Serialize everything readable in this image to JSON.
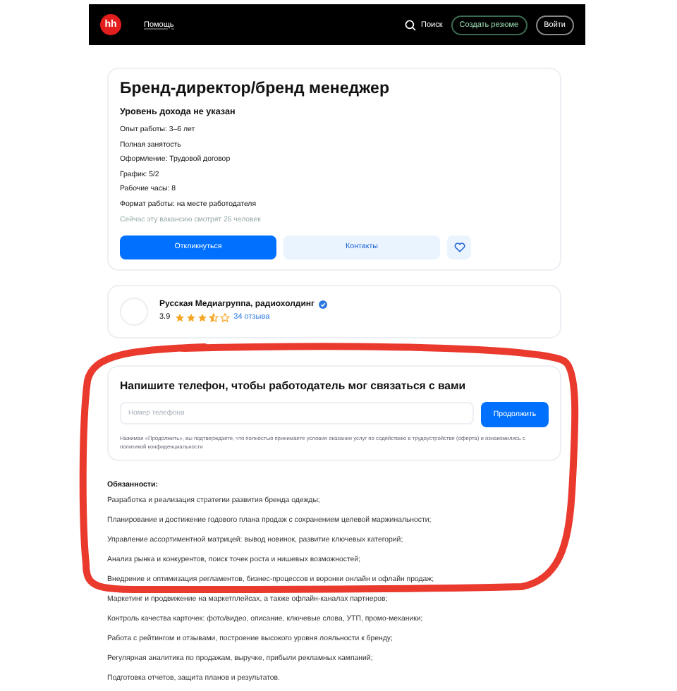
{
  "header": {
    "logo": "hh",
    "help_link": "Помощь",
    "search": "Поиск",
    "create_resume": "Создать резюме",
    "login": "Войти"
  },
  "vacancy": {
    "title": "Бренд-директор/бренд менеджер",
    "salary": "Уровень дохода не указан",
    "details": [
      "Опыт работы: 3–6 лет",
      "Полная занятость",
      "Оформление:  Трудовой договор",
      "График: 5/2",
      "Рабочие часы: 8",
      "Формат работы: на месте работодателя"
    ],
    "viewers": "Сейчас эту вакансию смотрят 26 человек",
    "apply_button": "Откликнуться",
    "contacts_button": "Контакты",
    "favorite": false
  },
  "employer": {
    "name": "Русская Медиагруппа, радиохолдинг",
    "verified": true,
    "rating": "3.9",
    "stars": 3.5,
    "reviews": "34 отзыва"
  },
  "phone_form": {
    "heading": "Напишите телефон, чтобы работодатель мог связаться с вами",
    "placeholder": "Номер телефона",
    "button": "Продолжить",
    "consent": "Нажимая «Продолжить», вы подтверждаете, что полностью принимаете условия оказания услуг по содействию в трудоустройстве (оферта) и ознакомились с политикой конфиденциальности"
  },
  "description": {
    "heading": "Обязанности:",
    "items": [
      "Разработка и реализация стратегии развития бренда одежды;",
      "Планирование и достижение годового плана продаж с сохранением целевой маржинальности;",
      "Управление ассортиментной матрицей: вывод новинок, развитие ключевых категорий;",
      "Анализ рынка и конкурентов, поиск точек роста и нишевых возможностей;",
      "Внедрение и оптимизация регламентов, бизнес-процессов и воронки онлайн и офлайн продаж;",
      "Маркетинг и продвижение на маркетплейсах, а также офлайн-каналах партнеров;",
      "Контроль качества карточек: фото/видео, описание, ключевые слова, УТП, промо-механики;",
      "Работа с рейтингом и отзывами, построение высокого уровня лояльности к бренду;",
      "Регулярная аналитика по продажам, выручке, прибыли рекламных кампаний;",
      "Подготовка отчетов, защита планов и результатов."
    ]
  }
}
